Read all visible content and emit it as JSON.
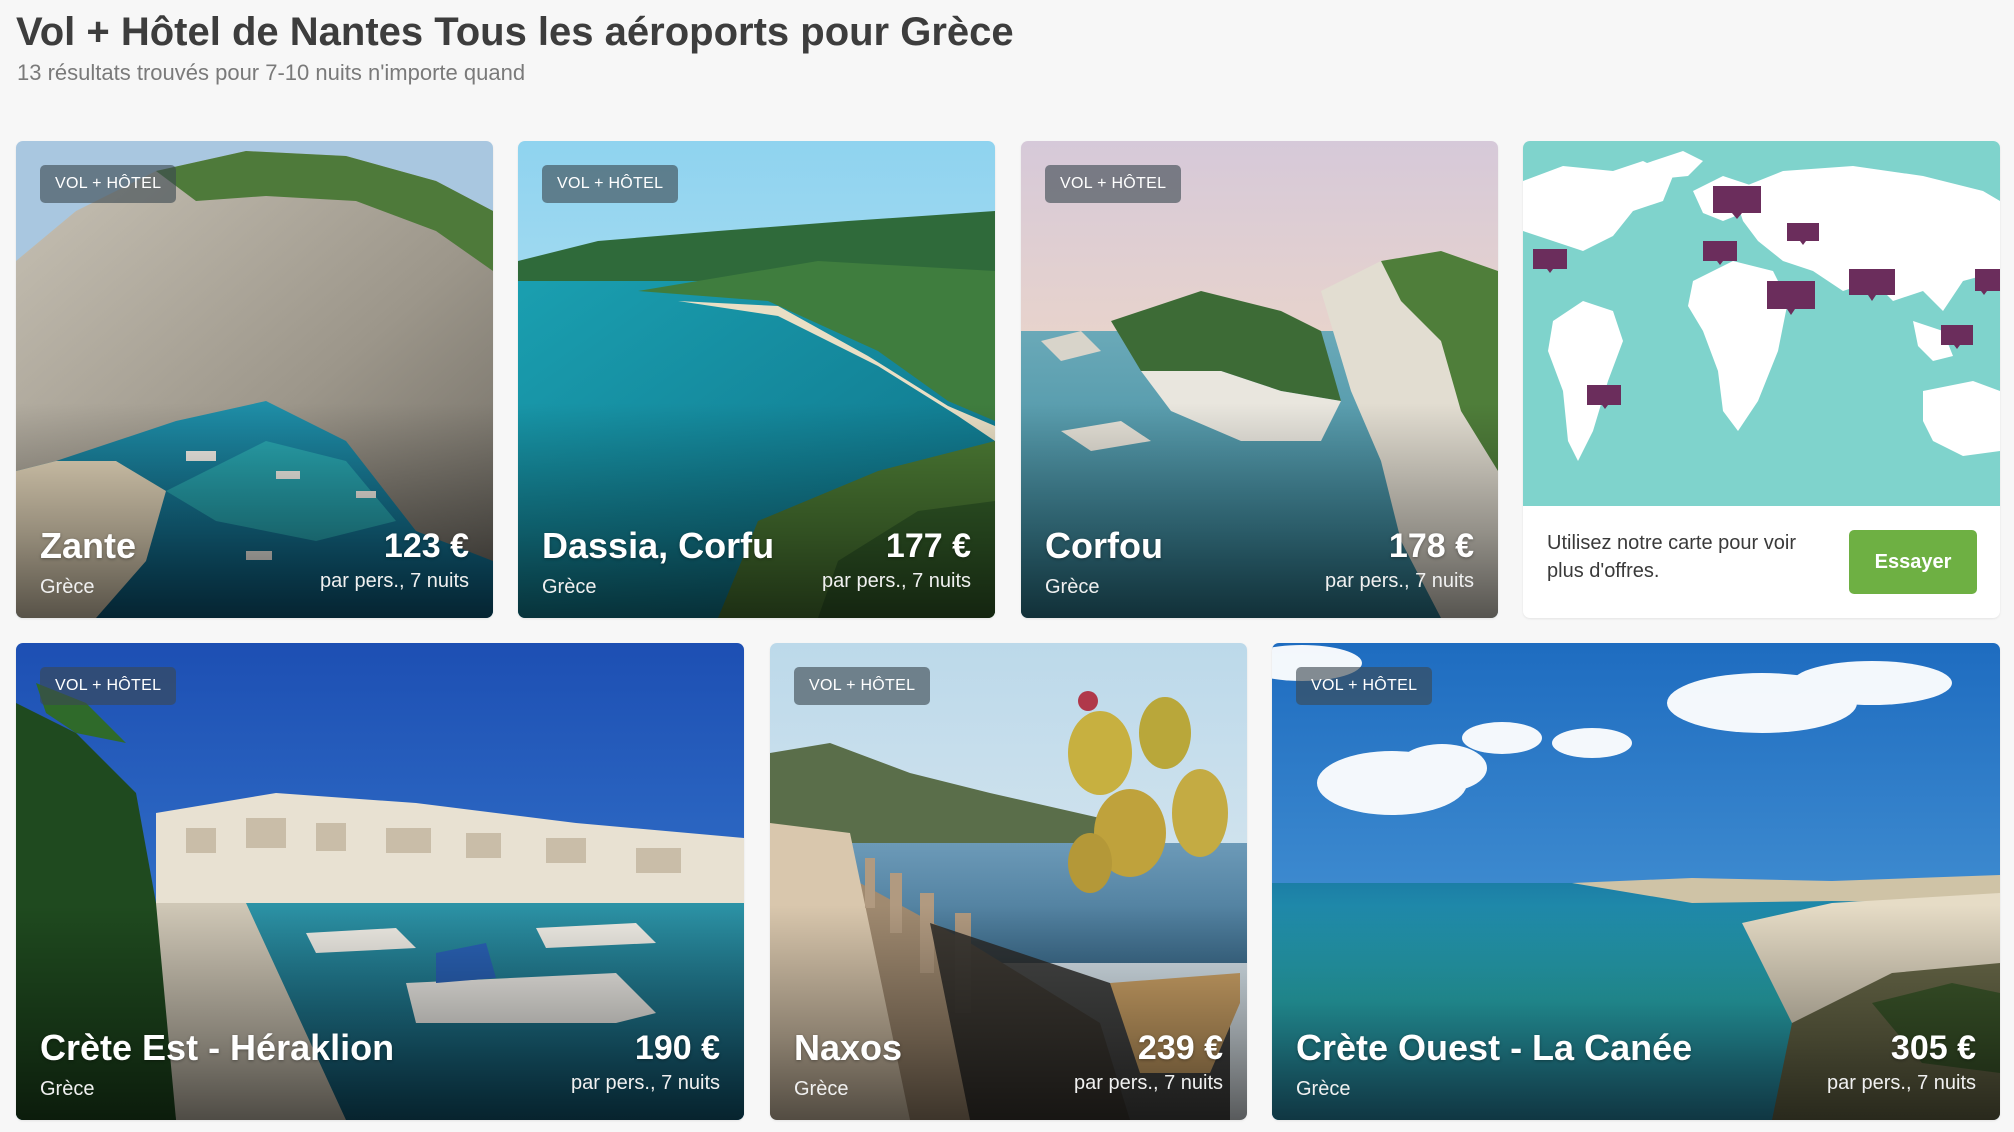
{
  "header": {
    "title": "Vol + Hôtel de Nantes Tous les aéroports pour Grèce",
    "subtitle": "13 résultats trouvés pour 7-10 nuits n'importe quand"
  },
  "results": [
    {
      "badge": "VOL + HÔTEL",
      "name": "Zante",
      "country": "Grèce",
      "price": "123 €",
      "price_note": "par pers., 7 nuits"
    },
    {
      "badge": "VOL + HÔTEL",
      "name": "Dassia, Corfu",
      "country": "Grèce",
      "price": "177 €",
      "price_note": "par pers., 7 nuits"
    },
    {
      "badge": "VOL + HÔTEL",
      "name": "Corfou",
      "country": "Grèce",
      "price": "178 €",
      "price_note": "par pers., 7 nuits"
    },
    {
      "badge": "VOL + HÔTEL",
      "name": "Crète Est - Héraklion",
      "country": "Grèce",
      "price": "190 €",
      "price_note": "par pers., 7 nuits"
    },
    {
      "badge": "VOL + HÔTEL",
      "name": "Naxos",
      "country": "Grèce",
      "price": "239 €",
      "price_note": "par pers., 7 nuits"
    },
    {
      "badge": "VOL + HÔTEL",
      "name": "Crète Ouest - La Canée",
      "country": "Grèce",
      "price": "305 €",
      "price_note": "par pers., 7 nuits"
    }
  ],
  "map_promo": {
    "text": "Utilisez notre carte pour voir plus d'offres.",
    "button_label": "Essayer"
  },
  "colors": {
    "accent_green": "#6eb043",
    "map_water": "#7fd3cc",
    "map_pin": "#6b2d5c",
    "page_background": "#f7f7f7"
  }
}
